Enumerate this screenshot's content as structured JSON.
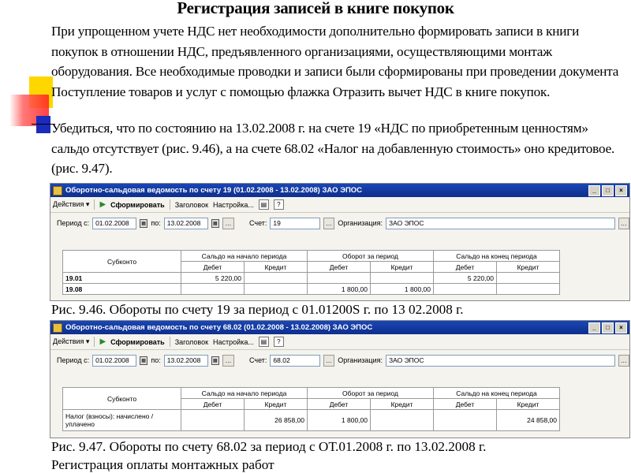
{
  "title": "Регистрация записей в книге покупок",
  "paragraph1": "При упрощенном учете НДС нет необходимости дополнительно формировать записи в книги покупок в отношении НДС, предъявленного организациями, осуществляющими монтаж оборудования. Все необходимые проводки и записи были сформированы при проведении документа Поступление товаров и услуг с помощью флажка Отразить вычет НДС в книге покупок.",
  "paragraph2": "Убедиться, что по состоянию на 13.02.2008 г. на счете 19 «НДС по приобретенным ценностям» сальдо отсутствует (рис. 9.46), а на счете 68.02 «Налог на добавленную стоимость» оно кредитовое. (рис. 9.47).",
  "caption1": "Рис. 9.46. Обороты по счету 19 за период с 01.01200S г. по 13 02.2008 г.",
  "caption2": "Рис. 9.47. Обороты по счету 68.02 за период с ОТ.01.2008 г. по 13.02.2008 г.",
  "footer": "Регистрация оплаты монтажных работ",
  "window1": {
    "title": "Оборотно-сальдовая ведомость по счету 19 (01.02.2008 - 13.02.2008) ЗАО ЭПОС",
    "toolbar": {
      "actions": "Действия ▾",
      "generate": "Сформировать",
      "header": "Заголовок",
      "settings": "Настройка..."
    },
    "params": {
      "period_label": "Период с:",
      "from": "01.02.2008",
      "to_label": "по:",
      "to": "13.02.2008",
      "account_label": "Счет:",
      "account": "19",
      "org_label": "Организация:",
      "org": "ЗАО ЭПОС"
    },
    "headers": {
      "subconto": "Субконто",
      "start": "Сальдо на начало периода",
      "turnover": "Оборот за период",
      "end": "Сальдо на конец периода",
      "debit": "Дебет",
      "credit": "Кредит"
    },
    "rows": [
      {
        "label": "19.01",
        "c1": "5 220,00",
        "c2": "",
        "c3": "",
        "c4": "",
        "c5": "5 220,00",
        "c6": ""
      },
      {
        "label": "19.08",
        "c1": "",
        "c2": "",
        "c3": "1 800,00",
        "c4": "1 800,00",
        "c5": "",
        "c6": ""
      }
    ]
  },
  "window2": {
    "title": "Оборотно-сальдовая ведомость по счету 68.02 (01.02.2008 - 13.02.2008) ЗАО ЭПОС",
    "toolbar": {
      "actions": "Действия ▾",
      "generate": "Сформировать",
      "header": "Заголовок",
      "settings": "Настройка..."
    },
    "params": {
      "period_label": "Период с:",
      "from": "01.02.2008",
      "to_label": "по:",
      "to": "13.02.2008",
      "account_label": "Счет:",
      "account": "68.02",
      "org_label": "Организация:",
      "org": "ЗАО ЭПОС"
    },
    "headers": {
      "subconto": "Субконто",
      "start": "Сальдо на начало периода",
      "turnover": "Оборот за период",
      "end": "Сальдо на конец периода",
      "debit": "Дебет",
      "credit": "Кредит"
    },
    "rows": [
      {
        "label": "Налог (взносы): начислено / уплачено",
        "c1": "",
        "c2": "26 858,00",
        "c3": "1 800,00",
        "c4": "",
        "c5": "",
        "c6": "24 858,00"
      }
    ]
  },
  "colors": {
    "titlebar": "#0e2f8c",
    "deco_yellow": "#ffd700",
    "deco_blue": "#1a2bbd",
    "deco_red": "#ff2020"
  }
}
